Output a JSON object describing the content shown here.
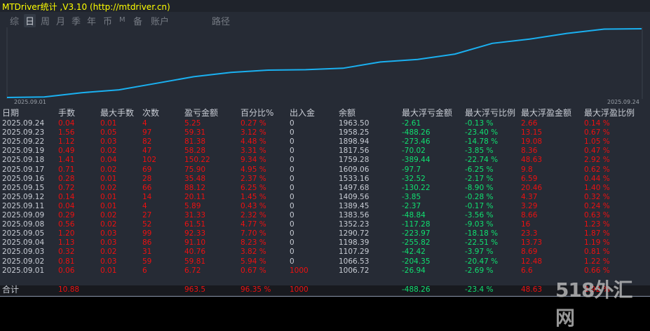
{
  "title": "MTDriver统计 ,V3.10 (http://mtdriver.cn)",
  "tabs": [
    {
      "label": "综"
    },
    {
      "label": "日",
      "active": true
    },
    {
      "label": "周"
    },
    {
      "label": "月"
    },
    {
      "label": "季"
    },
    {
      "label": "年"
    },
    {
      "label": "币"
    },
    {
      "label": "M"
    },
    {
      "label": "备"
    },
    {
      "label": "账户"
    },
    {
      "label": "路径"
    }
  ],
  "chart": {
    "start_label": "2025.09.01",
    "end_label": "2025.09.24",
    "line_color": "#1ab0f0"
  },
  "columns": [
    "日期",
    "手数",
    "最大手数",
    "次数",
    "盈亏金额",
    "百分比%",
    "出入金",
    "余额",
    "最大浮亏金额",
    "最大浮亏比例",
    "最大浮盈金额",
    "最大浮盈比例"
  ],
  "rows": [
    [
      "2025.09.24",
      "0.04",
      "0.01",
      "4",
      "5.25",
      "0.27 %",
      "0",
      "1963.50",
      "-2.61",
      "-0.13 %",
      "2.66",
      "0.14 %"
    ],
    [
      "2025.09.23",
      "1.56",
      "0.05",
      "97",
      "59.31",
      "3.12 %",
      "0",
      "1958.25",
      "-488.26",
      "-23.40 %",
      "13.15",
      "0.67 %"
    ],
    [
      "2025.09.22",
      "1.12",
      "0.03",
      "82",
      "81.38",
      "4.48 %",
      "0",
      "1898.94",
      "-273.46",
      "-14.78 %",
      "19.08",
      "1.05 %"
    ],
    [
      "2025.09.19",
      "0.49",
      "0.02",
      "47",
      "58.28",
      "3.31 %",
      "0",
      "1817.56",
      "-70.02",
      "-3.85 %",
      "8.36",
      "0.47 %"
    ],
    [
      "2025.09.18",
      "1.41",
      "0.04",
      "102",
      "150.22",
      "9.34 %",
      "0",
      "1759.28",
      "-389.44",
      "-22.74 %",
      "48.63",
      "2.92 %"
    ],
    [
      "2025.09.17",
      "0.71",
      "0.02",
      "69",
      "75.90",
      "4.95 %",
      "0",
      "1609.06",
      "-97.7",
      "-6.25 %",
      "9.8",
      "0.62 %"
    ],
    [
      "2025.09.16",
      "0.28",
      "0.01",
      "28",
      "35.48",
      "2.37 %",
      "0",
      "1533.16",
      "-32.52",
      "-2.17 %",
      "6.59",
      "0.44 %"
    ],
    [
      "2025.09.15",
      "0.72",
      "0.02",
      "66",
      "88.12",
      "6.25 %",
      "0",
      "1497.68",
      "-130.22",
      "-8.90 %",
      "20.46",
      "1.40 %"
    ],
    [
      "2025.09.12",
      "0.14",
      "0.01",
      "14",
      "20.11",
      "1.45 %",
      "0",
      "1409.56",
      "-3.85",
      "-0.28 %",
      "4.37",
      "0.32 %"
    ],
    [
      "2025.09.11",
      "0.04",
      "0.01",
      "4",
      "5.89",
      "0.43 %",
      "0",
      "1389.45",
      "-2.37",
      "-0.17 %",
      "3.29",
      "0.24 %"
    ],
    [
      "2025.09.09",
      "0.29",
      "0.02",
      "27",
      "31.33",
      "2.32 %",
      "0",
      "1383.56",
      "-48.84",
      "-3.56 %",
      "8.66",
      "0.63 %"
    ],
    [
      "2025.09.08",
      "0.56",
      "0.02",
      "52",
      "61.51",
      "4.77 %",
      "0",
      "1352.23",
      "-117.28",
      "-9.03 %",
      "16",
      "1.23 %"
    ],
    [
      "2025.09.05",
      "1.20",
      "0.03",
      "99",
      "92.33",
      "7.70 %",
      "0",
      "1290.72",
      "-223.97",
      "-18.18 %",
      "23.3",
      "1.87 %"
    ],
    [
      "2025.09.04",
      "1.13",
      "0.03",
      "86",
      "91.10",
      "8.23 %",
      "0",
      "1198.39",
      "-255.82",
      "-22.51 %",
      "13.73",
      "1.19 %"
    ],
    [
      "2025.09.03",
      "0.32",
      "0.02",
      "31",
      "40.76",
      "3.82 %",
      "0",
      "1107.29",
      "-42.42",
      "-3.97 %",
      "8.69",
      "0.81 %"
    ],
    [
      "2025.09.02",
      "0.81",
      "0.03",
      "59",
      "59.81",
      "5.94 %",
      "0",
      "1066.53",
      "-204.35",
      "-20.47 %",
      "12.48",
      "1.22 %"
    ],
    [
      "2025.09.01",
      "0.06",
      "0.01",
      "6",
      "6.72",
      "0.67 %",
      "1000",
      "1006.72",
      "-26.94",
      "-2.69 %",
      "6.6",
      "0.66 %"
    ]
  ],
  "total": [
    "合计",
    "10.88",
    "",
    "",
    "963.5",
    "96.35 %",
    "1000",
    "",
    "-488.26",
    "-23.4 %",
    "48.63",
    "2.92 %"
  ],
  "watermark": "518外汇网"
}
